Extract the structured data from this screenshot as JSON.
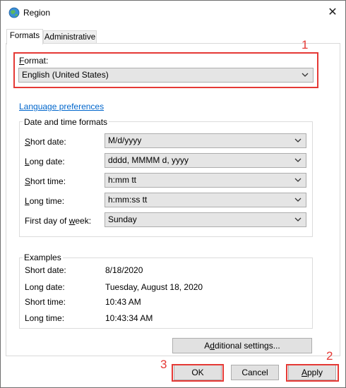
{
  "window": {
    "title": "Region",
    "close_glyph": "✕"
  },
  "tabs": [
    {
      "label": "Formats",
      "active": true
    },
    {
      "label": "Administrative",
      "active": false
    }
  ],
  "format": {
    "label_prefix": "",
    "label_underlined": "F",
    "label_rest": "ormat:",
    "value": "English (United States)"
  },
  "language_link": "Language preferences",
  "datetime_group": {
    "title": "Date and time formats",
    "rows": [
      {
        "label_u": "S",
        "label_rest": "hort date:",
        "value": "M/d/yyyy"
      },
      {
        "label_u": "L",
        "label_rest": "ong date:",
        "value": "dddd, MMMM d, yyyy"
      },
      {
        "label_u": "S",
        "label_rest": "hort time:",
        "value": "h:mm tt"
      },
      {
        "label_u": "L",
        "label_rest": "ong time:",
        "value": "h:mm:ss tt"
      },
      {
        "label_pre": "First day of ",
        "label_u": "w",
        "label_rest": "eek:",
        "value": "Sunday"
      }
    ]
  },
  "examples": {
    "title": "Examples",
    "rows": [
      {
        "label": "Short date:",
        "value": "8/18/2020"
      },
      {
        "label": "Long date:",
        "value": "Tuesday, August 18, 2020"
      },
      {
        "label": "Short time:",
        "value": "10:43 AM"
      },
      {
        "label": "Long time:",
        "value": "10:43:34 AM"
      }
    ]
  },
  "additional_settings": {
    "pre": "A",
    "u": "d",
    "rest": "ditional settings..."
  },
  "buttons": {
    "ok": "OK",
    "cancel": "Cancel",
    "apply_u": "A",
    "apply_rest": "pply"
  },
  "annotations": {
    "one": "1",
    "two": "2",
    "three": "3"
  },
  "colors": {
    "annotation_red": "#e53935",
    "link_blue": "#0066cc",
    "combo_bg": "#e5e5e5"
  },
  "icons": {
    "app": "globe-icon",
    "close": "close-icon",
    "dropdown": "chevron-down-icon"
  }
}
